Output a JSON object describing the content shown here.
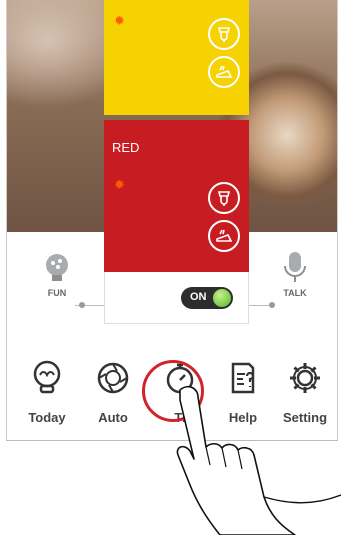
{
  "cards": {
    "red_label": "RED"
  },
  "toggle": {
    "label": "ON",
    "state": "on",
    "knob_color": "#52b52a"
  },
  "modes": {
    "left_label": "FUN",
    "right_label": "TALK"
  },
  "nav": {
    "items": [
      {
        "label": "Today",
        "icon": "lightbulb-icon"
      },
      {
        "label": "Auto",
        "icon": "shutter-icon"
      },
      {
        "label": "Ti",
        "icon": "stopwatch-icon"
      },
      {
        "label": "Help",
        "icon": "help-document-icon"
      },
      {
        "label": "Setting",
        "icon": "gear-icon"
      }
    ]
  },
  "colors": {
    "yellow_card": "#f5d200",
    "red_card": "#c81c23",
    "highlight_ring": "#d3232a"
  }
}
